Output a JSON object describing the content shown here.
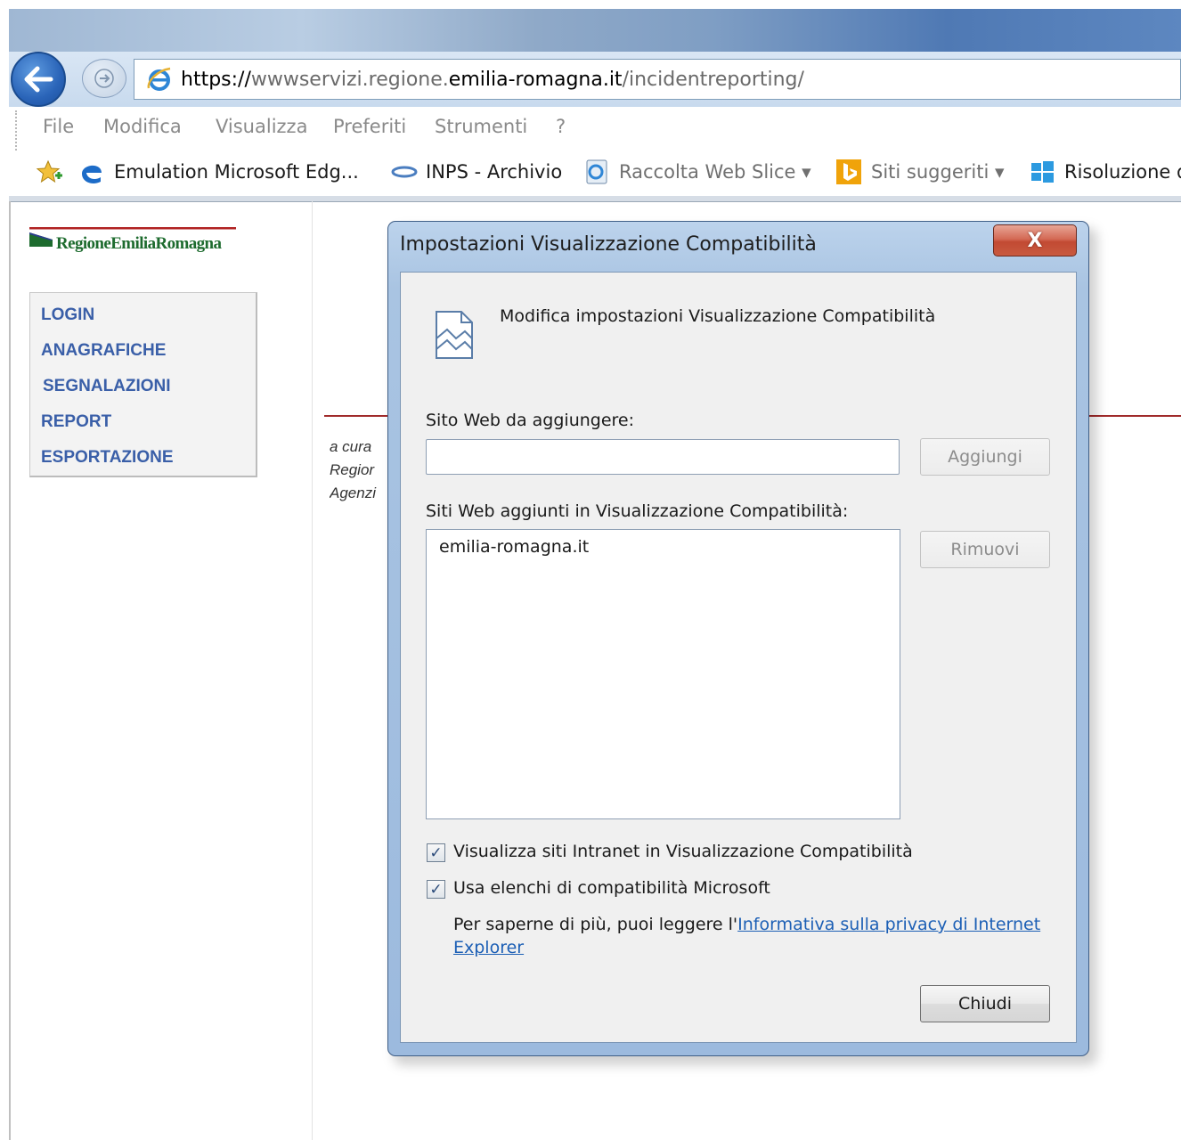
{
  "browser": {
    "url_prefix": "https://",
    "url_host_light": "wwwservizi.regione.",
    "url_host_dark": "emilia-romagna.it",
    "url_path": "/incidentreporting/",
    "menu": [
      "File",
      "Modifica",
      "Visualizza",
      "Preferiti",
      "Strumenti",
      "?"
    ],
    "favorites": [
      {
        "label": "Emulation  Microsoft Edg...",
        "icon": "edge-icon"
      },
      {
        "label": "INPS - Archivio",
        "icon": "link-icon"
      },
      {
        "label": "Raccolta Web Slice ▾",
        "icon": "web-slice-icon"
      },
      {
        "label": "Siti suggeriti ▾",
        "icon": "bing-icon"
      },
      {
        "label": "Risoluzione d",
        "icon": "windows-icon"
      }
    ]
  },
  "page": {
    "logo_text": "RegioneEmiliaRomagna",
    "nav": [
      "LOGIN",
      "ANAGRAFICHE",
      "SEGNALAZIONI",
      "REPORT",
      "ESPORTAZIONE"
    ],
    "credit_lines": [
      "a cura",
      "Regior",
      "Agenzi"
    ]
  },
  "dialog": {
    "title": "Impostazioni Visualizzazione Compatibilità",
    "close_label": "X",
    "heading": "Modifica impostazioni Visualizzazione Compatibilità",
    "site_to_add_label": "Sito Web da aggiungere:",
    "site_to_add_value": "",
    "add_button": "Aggiungi",
    "added_sites_label": "Siti Web aggiunti in Visualizzazione Compatibilità:",
    "added_sites": [
      "emilia-romagna.it"
    ],
    "remove_button": "Rimuovi",
    "checkbox_intranet": {
      "label": "Visualizza siti Intranet in Visualizzazione Compatibilità",
      "checked": true
    },
    "checkbox_microsoft": {
      "label": "Usa elenchi di compatibilità Microsoft",
      "checked": true
    },
    "info_text": "Per saperne di più, puoi leggere l'",
    "info_link_line1": "Informativa sulla privacy di Internet",
    "info_link_line2": "Explorer",
    "close_button": "Chiudi"
  }
}
